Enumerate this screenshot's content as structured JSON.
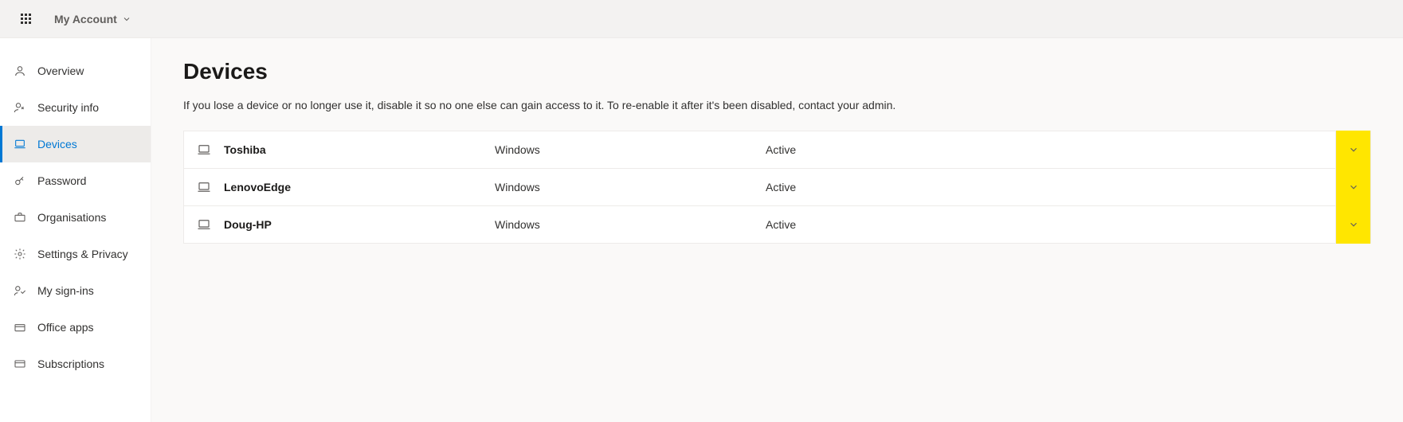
{
  "header": {
    "account_label": "My Account"
  },
  "sidebar": {
    "items": [
      {
        "label": "Overview"
      },
      {
        "label": "Security info"
      },
      {
        "label": "Devices"
      },
      {
        "label": "Password"
      },
      {
        "label": "Organisations"
      },
      {
        "label": "Settings & Privacy"
      },
      {
        "label": "My sign-ins"
      },
      {
        "label": "Office apps"
      },
      {
        "label": "Subscriptions"
      }
    ]
  },
  "page": {
    "title": "Devices",
    "subtitle": "If you lose a device or no longer use it, disable it so no one else can gain access to it. To re-enable it after it's been disabled, contact your admin."
  },
  "devices": [
    {
      "name": "Toshiba",
      "os": "Windows",
      "status": "Active"
    },
    {
      "name": "LenovoEdge",
      "os": "Windows",
      "status": "Active"
    },
    {
      "name": "Doug-HP",
      "os": "Windows",
      "status": "Active"
    }
  ]
}
